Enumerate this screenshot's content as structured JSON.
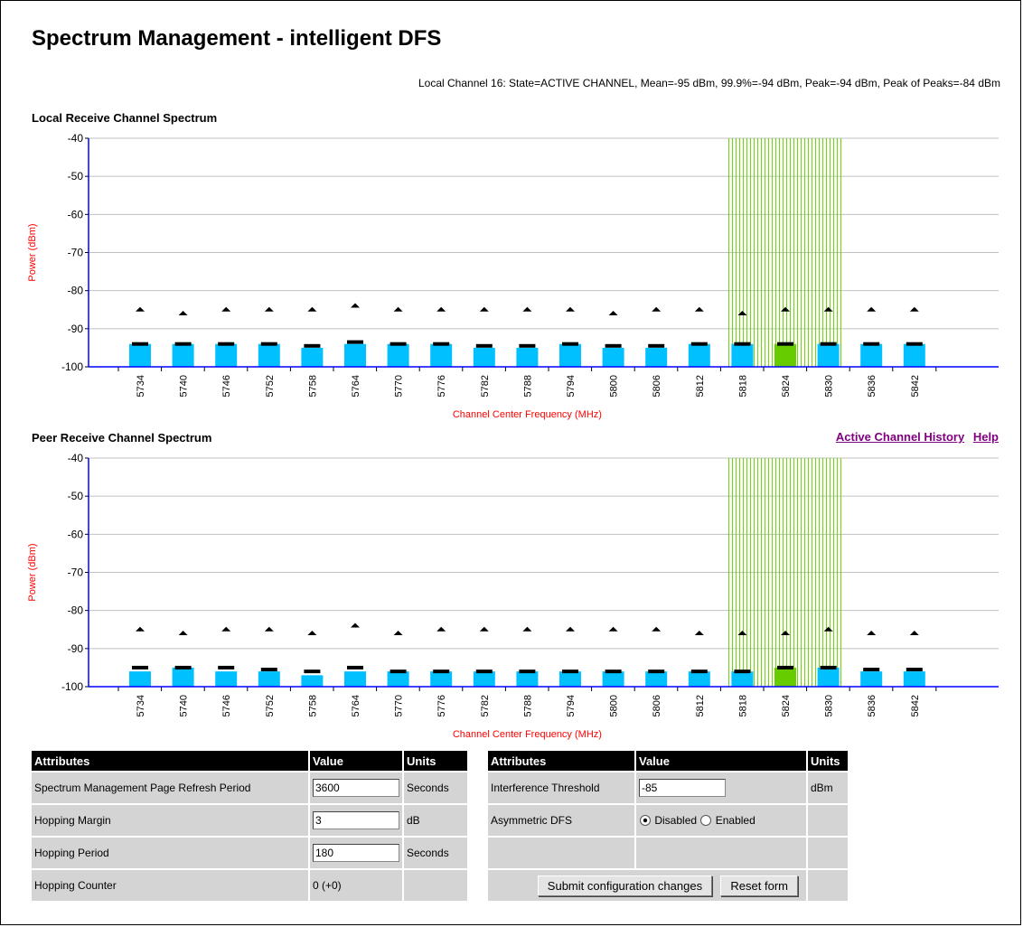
{
  "page": {
    "title": "Spectrum Management - intelligent DFS",
    "status_line": "Local Channel 16: State=ACTIVE CHANNEL, Mean=-95 dBm, 99.9%=-94 dBm, Peak=-94 dBm, Peak of Peaks=-84 dBm"
  },
  "links": {
    "history": "Active Channel History",
    "help": "Help"
  },
  "colors": {
    "bar": "#00c0ff",
    "active_bar": "#66cc00",
    "active_lines": "#66cc00",
    "axis": "#0000ff",
    "axis_label": "#ff0000",
    "grid": "#c0c0c0"
  },
  "chart_data": [
    {
      "type": "bar",
      "title": "Local Receive Channel Spectrum",
      "xlabel": "Channel Center Frequency (MHz)",
      "ylabel": "Power (dBm)",
      "ylim": [
        -100,
        -40
      ],
      "yticks": [
        -40,
        -50,
        -60,
        -70,
        -80,
        -90,
        -100
      ],
      "grid": true,
      "categories": [
        "5734",
        "5740",
        "5746",
        "5752",
        "5758",
        "5764",
        "5770",
        "5776",
        "5782",
        "5788",
        "5794",
        "5800",
        "5806",
        "5812",
        "5818",
        "5824",
        "5830",
        "5836",
        "5842"
      ],
      "active_channel": "5824",
      "series": [
        {
          "name": "Mean",
          "values": [
            -94,
            -94,
            -94,
            -94,
            -95,
            -94,
            -94,
            -94,
            -95,
            -95,
            -94,
            -95,
            -95,
            -94,
            -94,
            -94,
            -94,
            -94,
            -94
          ]
        },
        {
          "name": "99.9%",
          "values": [
            -94,
            -94,
            -94,
            -94,
            -94.5,
            -93.5,
            -94,
            -94,
            -94.5,
            -94.5,
            -94,
            -94.5,
            -94.5,
            -94,
            -94,
            -94,
            -94,
            -94,
            -94
          ]
        },
        {
          "name": "Peak of Peaks",
          "values": [
            -85,
            -86,
            -85,
            -85,
            -85,
            -84,
            -85,
            -85,
            -85,
            -85,
            -85,
            -86,
            -85,
            -85,
            -86,
            -85,
            -85,
            -85,
            -85
          ]
        }
      ]
    },
    {
      "type": "bar",
      "title": "Peer Receive Channel Spectrum",
      "xlabel": "Channel Center Frequency (MHz)",
      "ylabel": "Power (dBm)",
      "ylim": [
        -100,
        -40
      ],
      "yticks": [
        -40,
        -50,
        -60,
        -70,
        -80,
        -90,
        -100
      ],
      "grid": true,
      "categories": [
        "5734",
        "5740",
        "5746",
        "5752",
        "5758",
        "5764",
        "5770",
        "5776",
        "5782",
        "5788",
        "5794",
        "5800",
        "5806",
        "5812",
        "5818",
        "5824",
        "5830",
        "5836",
        "5842"
      ],
      "active_channel": "5824",
      "series": [
        {
          "name": "Mean",
          "values": [
            -96,
            -95,
            -96,
            -96,
            -97,
            -96,
            -96,
            -96,
            -96,
            -96,
            -96,
            -96,
            -96,
            -96,
            -96,
            -95,
            -95,
            -96,
            -96
          ]
        },
        {
          "name": "99.9%",
          "values": [
            -95,
            -95,
            -95,
            -95.5,
            -96,
            -95,
            -96,
            -96,
            -96,
            -96,
            -96,
            -96,
            -96,
            -96,
            -96,
            -95,
            -95,
            -95.5,
            -95.5
          ]
        },
        {
          "name": "Peak of Peaks",
          "values": [
            -85,
            -86,
            -85,
            -85,
            -86,
            -84,
            -86,
            -85,
            -85,
            -85,
            -85,
            -85,
            -85,
            -86,
            -86,
            -86,
            -85,
            -86,
            -86
          ]
        }
      ]
    }
  ],
  "table_left": {
    "headers": [
      "Attributes",
      "Value",
      "Units"
    ],
    "rows": [
      {
        "attr": "Spectrum Management Page Refresh Period",
        "value": "3600",
        "units": "Seconds"
      },
      {
        "attr": "Hopping Margin",
        "value": "3",
        "units": "dB"
      },
      {
        "attr": "Hopping Period",
        "value": "180",
        "units": "Seconds"
      },
      {
        "attr": "Hopping Counter",
        "value": "0 (+0)",
        "units": ""
      }
    ]
  },
  "table_right": {
    "headers": [
      "Attributes",
      "Value",
      "Units"
    ],
    "threshold": {
      "attr": "Interference Threshold",
      "value": "-85",
      "units": "dBm"
    },
    "asym": {
      "attr": "Asymmetric DFS",
      "disabled": "Disabled",
      "enabled": "Enabled",
      "selected": "Disabled"
    },
    "submit": "Submit configuration changes",
    "reset": "Reset form"
  }
}
